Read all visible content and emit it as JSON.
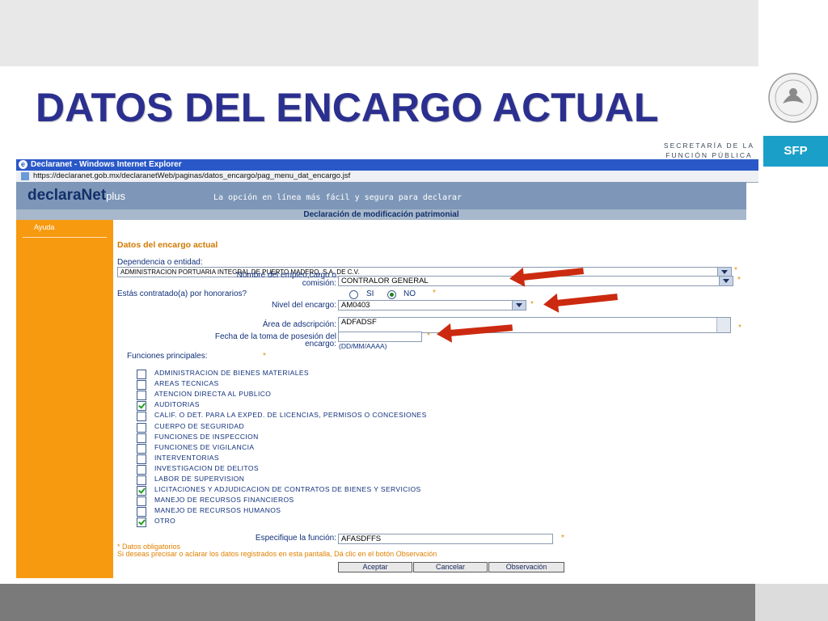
{
  "slide": {
    "title": "DATOS DEL ENCARGO ACTUAL",
    "secretaria_line1": "SECRETARÍA DE LA",
    "secretaria_line2": "FUNCIÓN PÚBLICA",
    "sfp": "SFP"
  },
  "browser": {
    "title": "Declaranet - Windows Internet Explorer",
    "url": "https://declaranet.gob.mx/declaranetWeb/paginas/datos_encargo/pag_menu_dat_encargo.jsf"
  },
  "app": {
    "logo_main": "declaraNet",
    "logo_plus": "plus",
    "tagline": "La opción en línea más fácil y segura para declarar",
    "subheader": "Declaración de modificación patrimonial",
    "sidebar_help": "Ayuda"
  },
  "form": {
    "section_title": "Datos del encargo actual",
    "dependencia_label": "Dependencia o entidad:",
    "dependencia_value": "ADMINISTRACION PORTUARIA INTEGRAL DE PUERTO MADERO, S.A. DE C.V.",
    "nombre_label_1": "Nombre del empleo,cargo o",
    "nombre_label_2": "comisión:",
    "nombre_value": "CONTRALOR GENERAL",
    "honorarios_label": "Estás contratado(a) por honorarios?",
    "si_label": "SI",
    "no_label": "NO",
    "nivel_label": "Nivel del encargo:",
    "nivel_value": "AM0403",
    "area_label": "Área de adscripción:",
    "area_value": "ADFADSF",
    "fecha_label_1": "Fecha de la toma de posesión del",
    "fecha_label_2": "encargo:",
    "fecha_value": "",
    "fecha_hint": "(DD/MM/AAAA)",
    "funciones_label": "Funciones principales:",
    "req_mark": "*",
    "funciones": [
      {
        "label": "ADMINISTRACION DE BIENES MATERIALES",
        "checked": false
      },
      {
        "label": "AREAS TECNICAS",
        "checked": false
      },
      {
        "label": "ATENCION DIRECTA AL PUBLICO",
        "checked": false
      },
      {
        "label": "AUDITORIAS",
        "checked": true
      },
      {
        "label": "CALIF. O DET. PARA LA EXPED. DE LICENCIAS, PERMISOS O CONCESIONES",
        "checked": false
      },
      {
        "label": "CUERPO DE SEGURIDAD",
        "checked": false
      },
      {
        "label": "FUNCIONES DE INSPECCION",
        "checked": false
      },
      {
        "label": "FUNCIONES DE VIGILANCIA",
        "checked": false
      },
      {
        "label": "INTERVENTORIAS",
        "checked": false
      },
      {
        "label": "INVESTIGACION DE DELITOS",
        "checked": false
      },
      {
        "label": "LABOR DE SUPERVISION",
        "checked": false
      },
      {
        "label": "LICITACIONES Y ADJUDICACION DE CONTRATOS DE BIENES Y SERVICIOS",
        "checked": true
      },
      {
        "label": "MANEJO DE RECURSOS FINANCIEROS",
        "checked": false
      },
      {
        "label": "MANEJO DE RECURSOS HUMANOS",
        "checked": false
      },
      {
        "label": "OTRO",
        "checked": true
      }
    ],
    "especifique_label": "Especifique la función:",
    "especifique_value": "AFASDFFS",
    "note_required": "* Datos obligatorios",
    "note_observacion": "Si deseas precisar o aclarar los datos registrados en esta pantalla, Dá clic en el botón Observación",
    "btn_aceptar": "Aceptar",
    "btn_cancelar": "Cancelar",
    "btn_observacion": "Observación"
  },
  "colors": {
    "title_blue": "#2b2f8f",
    "sidebar_orange": "#f79a10",
    "arrow_red": "#cc2a10",
    "sfp_cyan": "#1aa0c8"
  },
  "icons": [
    "ie-logo-icon",
    "page-favicon-icon",
    "seal-icon",
    "dropdown-arrow-icon",
    "pointer-arrow-icon"
  ]
}
